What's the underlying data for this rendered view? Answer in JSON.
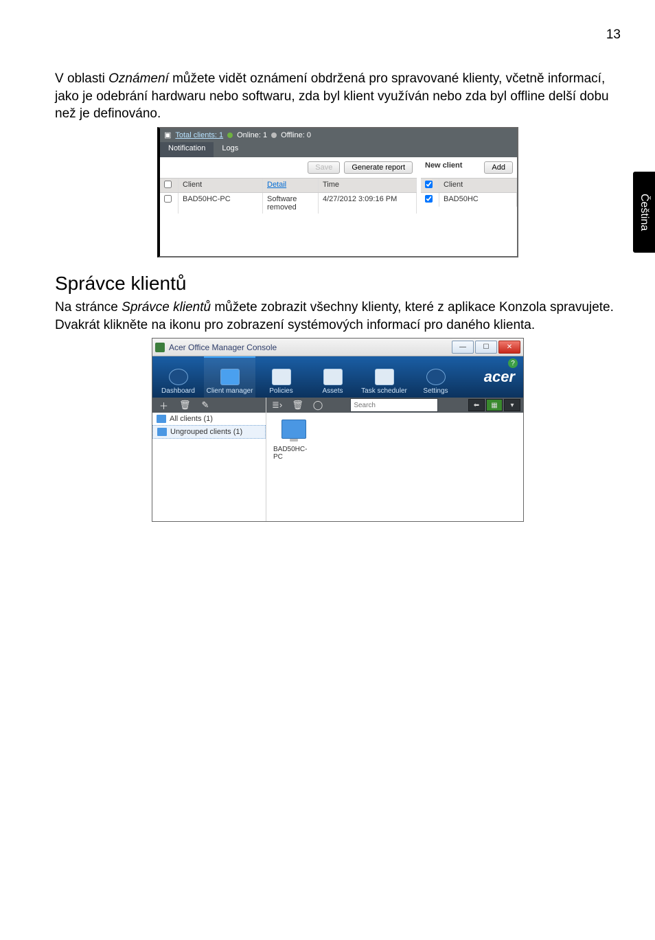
{
  "page_number": "13",
  "para1": {
    "pre": "V oblasti ",
    "italic": "Oznámení",
    "post": " můžete vidět oznámení obdržená pro spravované klienty, včetně informací, jako je odebrání hardwaru nebo softwaru, zda byl klient využíván nebo zda byl offline delší dobu než je definováno."
  },
  "heading": "Správce klientů",
  "para2": {
    "pre": "Na stránce ",
    "italic": "Správce klientů",
    "post": " můžete zobrazit všechny klienty, které z aplikace Konzola spravujete. Dvakrát klikněte na ikonu pro zobrazení systémových informací pro daného klienta."
  },
  "lang_tab": "Čeština",
  "shot1": {
    "total_clients": "Total clients: 1",
    "online": "Online: 1",
    "offline": "Offline: 0",
    "tabs": {
      "notification": "Notification",
      "logs": "Logs"
    },
    "buttons": {
      "save": "Save",
      "generate": "Generate report",
      "add": "Add"
    },
    "headers": {
      "client": "Client",
      "detail": "Detail",
      "time": "Time"
    },
    "row": {
      "client": "BAD50HC-PC",
      "detail": "Software removed",
      "time": "4/27/2012 3:09:16 PM"
    },
    "right": {
      "new_client": "New client",
      "client_header": "Client",
      "client_value": "BAD50HC"
    }
  },
  "shot2": {
    "title": "Acer Office Manager Console",
    "nav": {
      "dashboard": "Dashboard",
      "client_manager": "Client manager",
      "policies": "Policies",
      "assets": "Assets",
      "task_scheduler": "Task scheduler",
      "settings": "Settings"
    },
    "brand": "acer",
    "help": "?",
    "sidebar": {
      "all_clients": "All clients (1)",
      "ungrouped": "Ungrouped clients (1)"
    },
    "search_placeholder": "Search",
    "client": "BAD50HC-PC"
  }
}
